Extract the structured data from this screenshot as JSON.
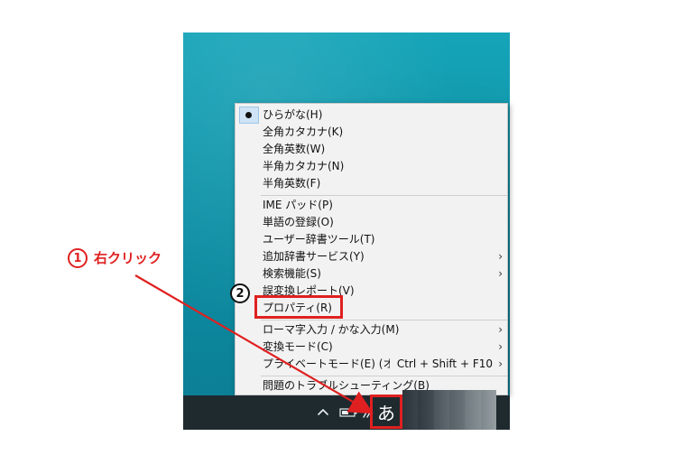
{
  "annotations": {
    "step1_number": "1",
    "step1_label": "右クリック",
    "step2_number": "2"
  },
  "taskbar": {
    "ime_indicator": "あ",
    "icons": [
      "chevron-up-icon",
      "battery-icon",
      "network-icon"
    ]
  },
  "menu": {
    "items": [
      {
        "label": "ひらがな(H)",
        "selected": true
      },
      {
        "label": "全角カタカナ(K)"
      },
      {
        "label": "全角英数(W)"
      },
      {
        "label": "半角カタカナ(N)"
      },
      {
        "label": "半角英数(F)"
      },
      {
        "label": "IME パッド(P)"
      },
      {
        "label": "単語の登録(O)"
      },
      {
        "label": "ユーザー辞書ツール(T)"
      },
      {
        "label": "追加辞書サービス(Y)",
        "submenu": true
      },
      {
        "label": "検索機能(S)",
        "submenu": true
      },
      {
        "label": "誤変換レポート(V)"
      },
      {
        "label": "プロパティ(R)",
        "highlighted": true
      },
      {
        "label": "ローマ字入力 / かな入力(M)",
        "submenu": true
      },
      {
        "label": "変換モード(C)",
        "submenu": true
      },
      {
        "label": "プライベートモード(E) (オフ)",
        "shortcut": "Ctrl + Shift + F10",
        "submenu": true
      },
      {
        "label": "問題のトラブルシューティング(B)"
      }
    ],
    "submenu_glyph": "›"
  },
  "colors": {
    "annotation_red": "#e02020",
    "menu_bg": "#f2f2f2",
    "taskbar_bg": "#1f2a2f"
  }
}
